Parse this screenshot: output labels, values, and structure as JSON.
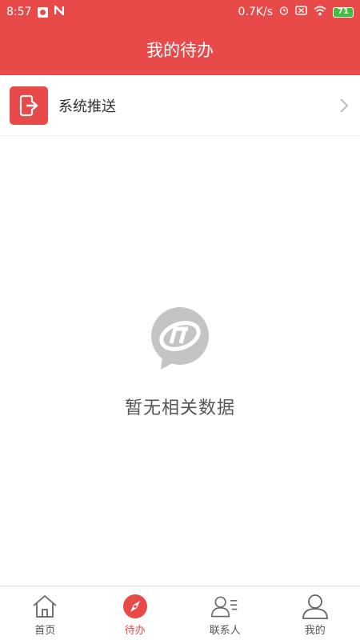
{
  "status_bar": {
    "time": "8:57",
    "net_speed": "0.7K/s",
    "battery_level": "71",
    "icons": [
      "app-notification-icon",
      "n-notification-icon",
      "alarm-icon",
      "sim-icon",
      "wifi-icon",
      "battery-icon"
    ]
  },
  "header": {
    "title": "我的待办"
  },
  "list": {
    "items": [
      {
        "label": "系统推送",
        "icon": "phone-exit-icon"
      }
    ]
  },
  "empty_state": {
    "text": "暂无相关数据",
    "icon": "logo-bubble-icon"
  },
  "tabs": [
    {
      "label": "首页",
      "icon": "home-icon",
      "active": false
    },
    {
      "label": "待办",
      "icon": "compass-icon",
      "active": true
    },
    {
      "label": "联系人",
      "icon": "contacts-icon",
      "active": false
    },
    {
      "label": "我的",
      "icon": "user-icon",
      "active": false
    }
  ],
  "colors": {
    "brand": "#e84a4a",
    "battery": "#3fbf3f"
  }
}
